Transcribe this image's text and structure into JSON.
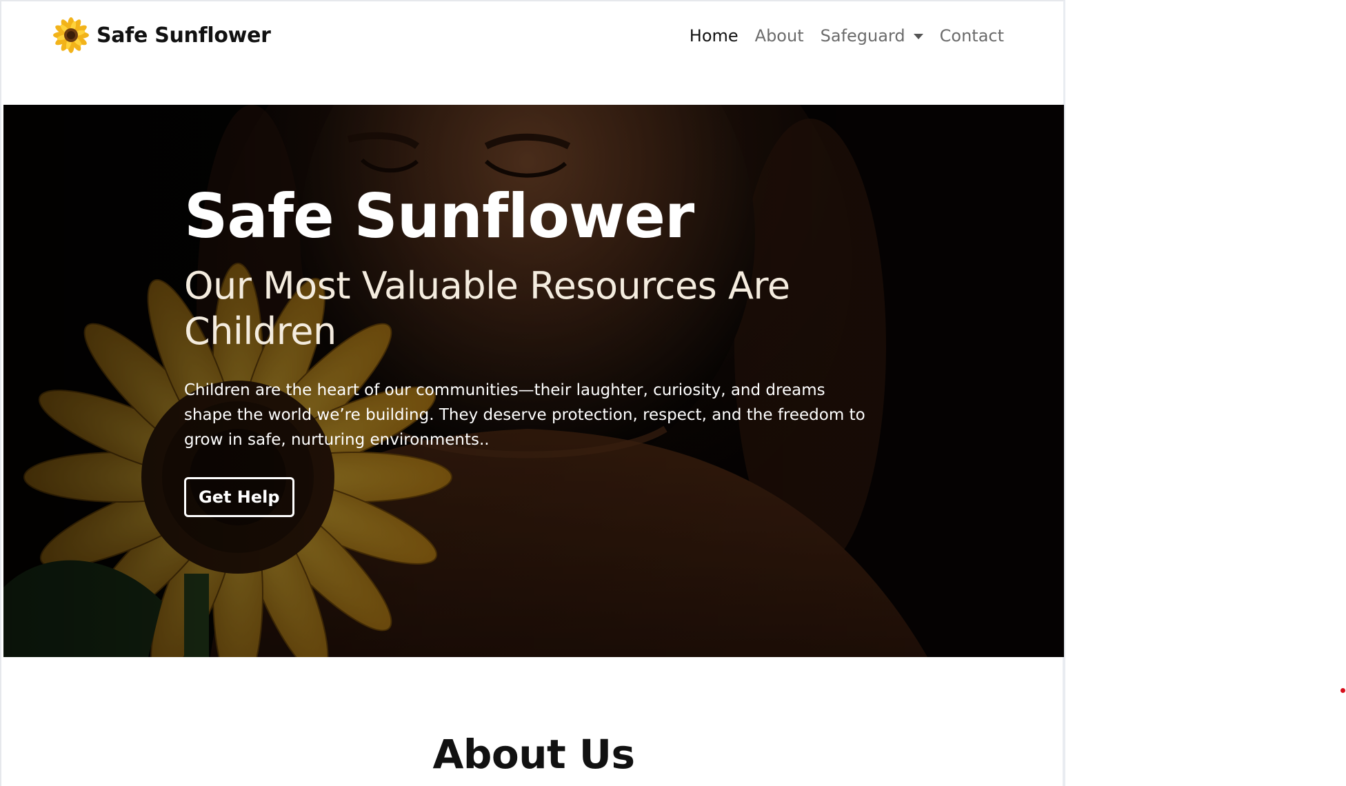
{
  "brand": {
    "name": "Safe Sunflower",
    "logo_icon": "sunflower-icon"
  },
  "nav": {
    "items": [
      {
        "label": "Home",
        "active": true
      },
      {
        "label": "About",
        "active": false
      },
      {
        "label": "Safeguard",
        "active": false,
        "dropdown": true
      },
      {
        "label": "Contact",
        "active": false
      }
    ]
  },
  "hero": {
    "title": "Safe Sunflower",
    "subtitle": "Our Most Valuable Resources Are Children",
    "text": "Children are the heart of our communities—their laughter, curiosity, and dreams shape the world we’re building. They deserve protection, respect, and the freedom to grow in safe, nurturing environments..",
    "button_label": "Get Help",
    "image_icon": "child-with-sunflower-photo"
  },
  "about": {
    "title": "About Us"
  },
  "colors": {
    "nav_active": "#111111",
    "nav_inactive": "#6b6b6b",
    "hero_overlay": "#0a0604",
    "petal": "#e3a521",
    "accent_dot": "#d6101c"
  }
}
